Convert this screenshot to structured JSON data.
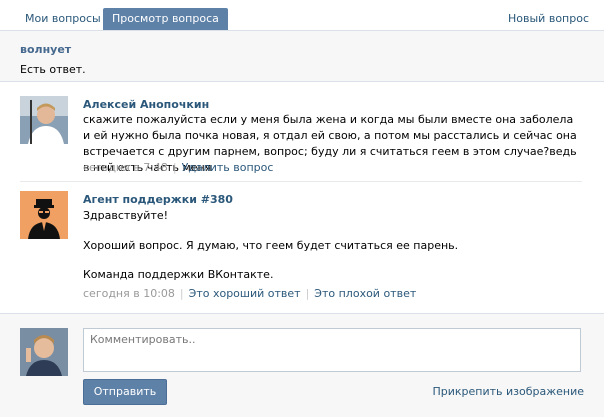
{
  "tabs": {
    "my_questions": "Мои вопросы",
    "view_question": "Просмотр вопроса",
    "new_question": "Новый вопрос"
  },
  "question": {
    "title": "волнует",
    "status": "Есть ответ."
  },
  "posts": [
    {
      "author": "Алексей Анопочкин",
      "text": "скажите пожалуйста если у меня была жена и когда мы были вместе она заболела и ей нужно была почка новая, я отдал ей свою, а потом мы расстались и сейчас она встречается с другим парнем, вопрос; буду ли я считаться геем в этом случае?ведь в ней есть часть меня",
      "time": "сегодня в 7:48",
      "action1": "Удалить вопрос"
    },
    {
      "author": "Агент поддержки #380",
      "greeting": "Здравствуйте!",
      "body": "Хороший вопрос. Я думаю, что геем будет считаться ее парень.",
      "signature": "Команда поддержки ВКонтакте.",
      "time": "сегодня в 10:08",
      "action1": "Это хороший ответ",
      "action2": "Это плохой ответ"
    }
  ],
  "comment": {
    "placeholder": "Комментировать..",
    "send_label": "Отправить",
    "attach_label": "Прикрепить изображение"
  },
  "colors": {
    "accent": "#5e81a8",
    "link": "#2b587a",
    "agent_avatar_bg": "#f0a062"
  }
}
